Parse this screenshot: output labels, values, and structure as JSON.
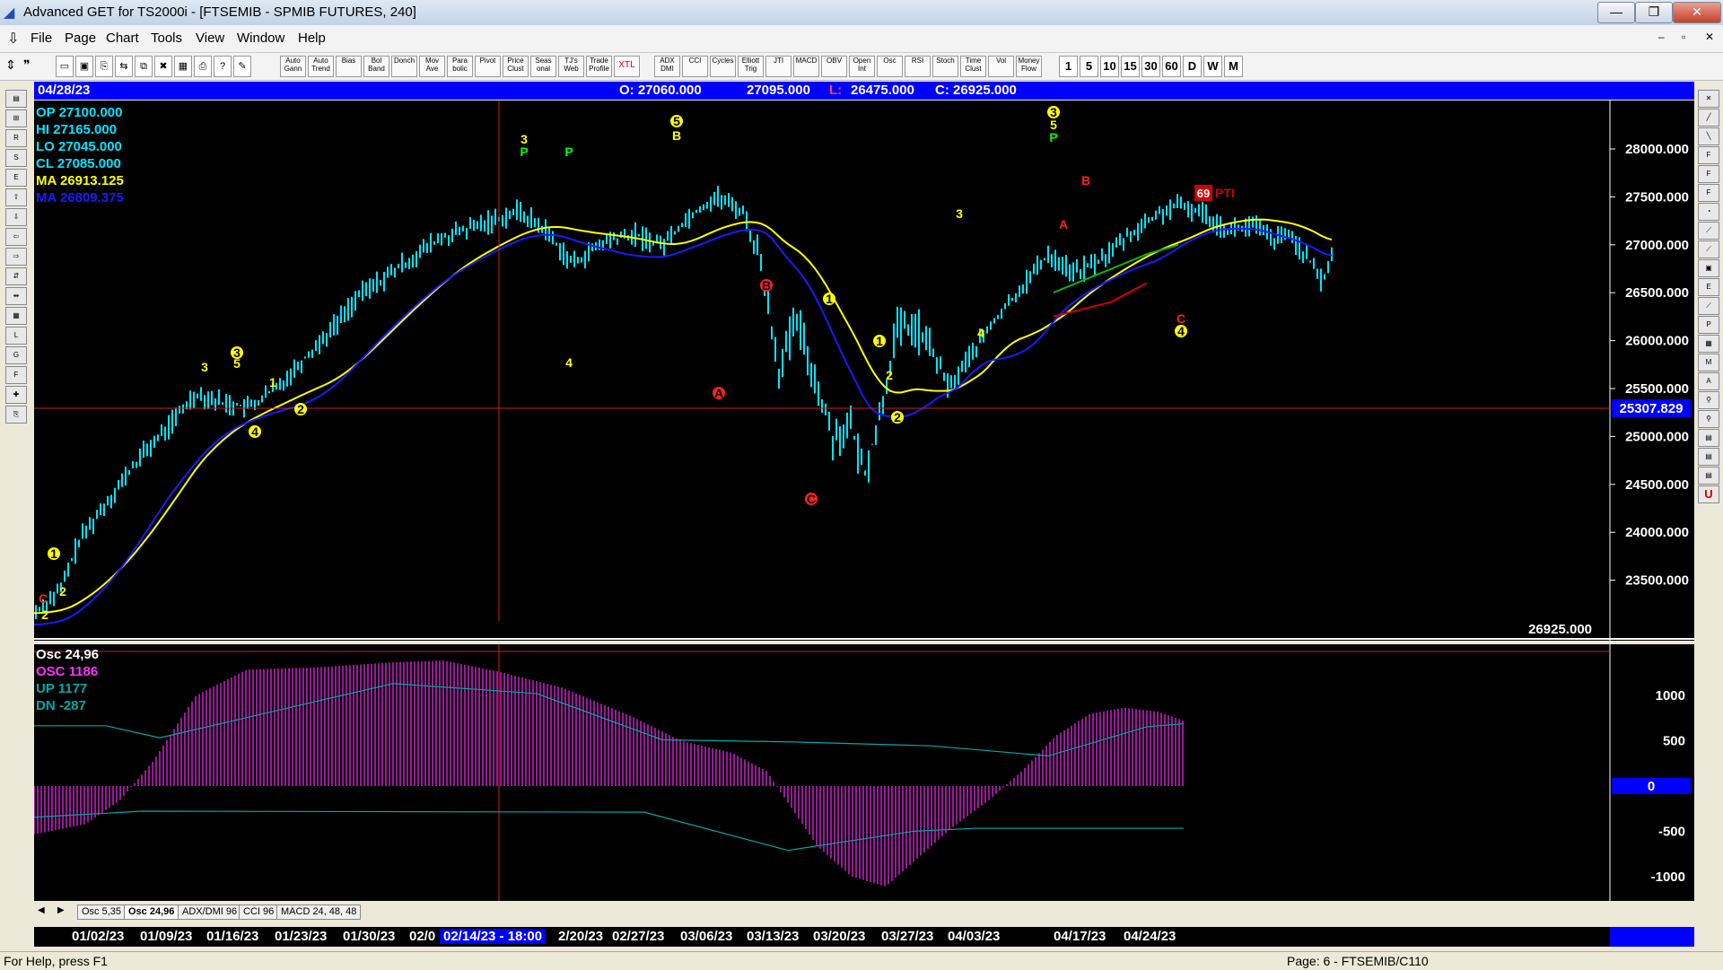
{
  "window": {
    "title": "Advanced GET for TS2000i - [FTSEMIB - SPMIB FUTURES, 240]",
    "min": "—",
    "max": "❐",
    "close": "✕"
  },
  "menu": [
    "File",
    "Page",
    "Chart",
    "Tools",
    "View",
    "Window",
    "Help"
  ],
  "toolbar": {
    "study_buttons": [
      "Auto Gann",
      "Auto Trend",
      "Bias",
      "Bol Band",
      "Donch",
      "Mov Ave",
      "Para bolic",
      "Pivot",
      "Price Clust",
      "Seas onal",
      "TJ's Web",
      "Trade Profile",
      "XTL",
      "ADX DMI",
      "CCI",
      "Cycles",
      "Elliott Trig",
      "JTI",
      "MACD",
      "OBV",
      "Open Int",
      "Osc",
      "RSI",
      "Stoch",
      "Time Clust",
      "Vol",
      "Money Flow"
    ],
    "timeframes": [
      "1",
      "5",
      "10",
      "15",
      "30",
      "60",
      "D",
      "W",
      "M"
    ]
  },
  "infobar": {
    "date": "04/28/23",
    "open": "O: 27060.000",
    "high": "27095.000",
    "low_label": "L:",
    "low": "26475.000",
    "close": "C: 26925.000"
  },
  "legend": {
    "op": "OP  27100.000",
    "hi": "HI   27165.000",
    "lo": "LO  27045.000",
    "cl": "CL  27085.000",
    "ma1": "MA  26913.125",
    "ma2": "MA  26809.375"
  },
  "price_axis": [
    "28000.000",
    "27500.000",
    "27000.000",
    "26500.000",
    "26000.000",
    "25500.000",
    "25000.000",
    "24500.000",
    "24000.000",
    "23500.000"
  ],
  "cursor_price": "25307.829",
  "last_price": "26925.000",
  "pti": {
    "value": "69",
    "label": "PTI"
  },
  "osc_legend": {
    "title": "Osc 24,96",
    "osc": "OSC 1186",
    "up": "UP   1177",
    "dn": "DN   -287"
  },
  "osc_axis": [
    "1000",
    "500",
    "0",
    "-500",
    "-1000"
  ],
  "tabs": [
    "Osc 5,35",
    "Osc 24,96",
    "ADX/DMI 96",
    "CCI 96",
    "MACD 24, 48, 48"
  ],
  "dates": [
    "01/02/23",
    "01/09/23",
    "01/16/23",
    "01/23/23",
    "01/30/23",
    "02/0",
    "02/14/23 - 18:00",
    "2/20/23",
    "02/27/23",
    "03/06/23",
    "03/13/23",
    "03/20/23",
    "03/27/23",
    "04/03/23",
    "04/17/23",
    "04/24/23"
  ],
  "status": {
    "left": "For Help, press F1",
    "right": "Page: 6 - FTSEMIB/C110"
  },
  "elliott_labels": [
    {
      "t": "C",
      "c": "#ff2020"
    },
    {
      "t": "2",
      "c": "#ffff00"
    },
    {
      "t": "1",
      "c": "#ffff00"
    },
    {
      "t": "2",
      "c": "#ffff00"
    },
    {
      "t": "3",
      "c": "#ffff00"
    },
    {
      "t": "3",
      "c": "#ffff00"
    },
    {
      "t": "5",
      "c": "#ffff00"
    },
    {
      "t": "4",
      "c": "#ffff00"
    },
    {
      "t": "1",
      "c": "#ffff00"
    },
    {
      "t": "2",
      "c": "#ffff00"
    },
    {
      "t": "3",
      "c": "#ffff00"
    },
    {
      "t": "P",
      "c": "#00ff00"
    },
    {
      "t": "P",
      "c": "#00ff00"
    },
    {
      "t": "4",
      "c": "#ffff00"
    },
    {
      "t": "5",
      "c": "#ffff00"
    },
    {
      "t": "B",
      "c": "#ffff00"
    },
    {
      "t": "B",
      "c": "#ff2020"
    },
    {
      "t": "A",
      "c": "#ff2020"
    },
    {
      "t": "C",
      "c": "#ff2020"
    },
    {
      "t": "1",
      "c": "#ffff00"
    },
    {
      "t": "1",
      "c": "#ffff00"
    },
    {
      "t": "2",
      "c": "#ffff00"
    },
    {
      "t": "2",
      "c": "#ffff00"
    },
    {
      "t": "3",
      "c": "#ffff00"
    },
    {
      "t": "4",
      "c": "#ffff00"
    },
    {
      "t": "3",
      "c": "#ffff00"
    },
    {
      "t": "5",
      "c": "#ffff00"
    },
    {
      "t": "P",
      "c": "#00ff00"
    },
    {
      "t": "B",
      "c": "#ff2020"
    },
    {
      "t": "A",
      "c": "#ff2020"
    },
    {
      "t": "C",
      "c": "#ff2020"
    },
    {
      "t": "4",
      "c": "#ffff00"
    }
  ],
  "colors": {
    "background": "#000000",
    "bars": "#00e5ff",
    "ma_fast": "#ffff00",
    "ma_slow": "#1a1aff",
    "osc": "#cc22cc",
    "band": "#00aaaa",
    "cursor": "#ff2020",
    "info": "#0000ff"
  }
}
